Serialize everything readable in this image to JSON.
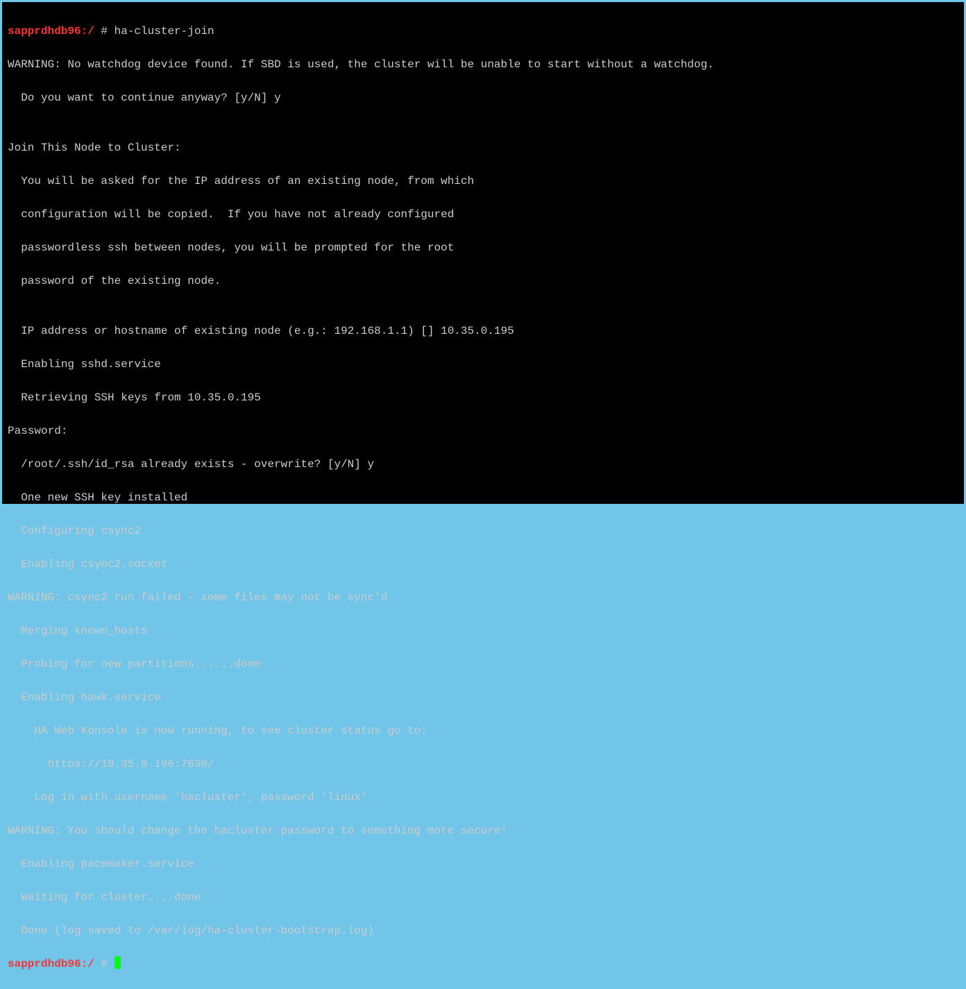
{
  "prompt1_host": "sapprdhdb96:/ ",
  "prompt1_hash": "# ",
  "prompt1_cmd": "ha-cluster-join",
  "l01": "WARNING: No watchdog device found. If SBD is used, the cluster will be unable to start without a watchdog.",
  "l02": "  Do you want to continue anyway? [y/N] y",
  "l03": "",
  "l04": "Join This Node to Cluster:",
  "l05": "  You will be asked for the IP address of an existing node, from which",
  "l06": "  configuration will be copied.  If you have not already configured",
  "l07": "  passwordless ssh between nodes, you will be prompted for the root",
  "l08": "  password of the existing node.",
  "l09": "",
  "l10": "  IP address or hostname of existing node (e.g.: 192.168.1.1) [] 10.35.0.195",
  "l11": "  Enabling sshd.service",
  "l12": "  Retrieving SSH keys from 10.35.0.195",
  "l13": "Password:",
  "l14": "  /root/.ssh/id_rsa already exists - overwrite? [y/N] y",
  "l15": "  One new SSH key installed",
  "l16": "  Configuring csync2",
  "l17": "  Enabling csync2.socket",
  "l18": "WARNING: csync2 run failed - some files may not be sync'd",
  "l19": "  Merging known_hosts",
  "l20": "  Probing for new partitions......done",
  "l21": "  Enabling hawk.service",
  "l22": "    HA Web Konsole is now running, to see cluster status go to:",
  "l23": "      https://10.35.0.196:7630/",
  "l24": "    Log in with username 'hacluster', password 'linux'",
  "l25": "WARNING: You should change the hacluster password to something more secure!",
  "l26": "  Enabling pacemaker.service",
  "l27": "  Waiting for cluster....done",
  "l28": "  Done (log saved to /var/log/ha-cluster-bootstrap.log)",
  "prompt2_host": "sapprdhdb96:/ ",
  "prompt2_hash": "# "
}
